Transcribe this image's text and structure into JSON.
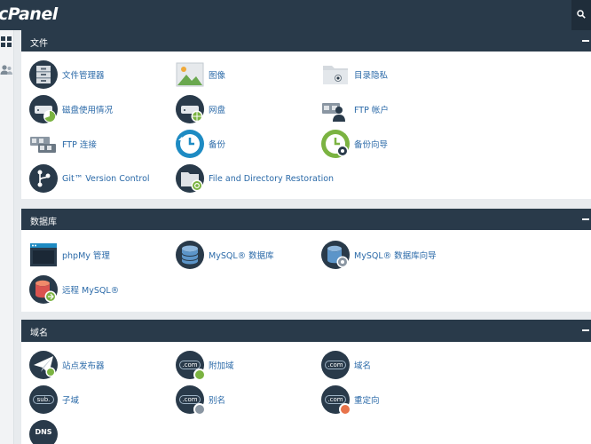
{
  "app": {
    "logo_text": "cPanel"
  },
  "colors": {
    "header": "#293a4a",
    "link": "#2b6aa8",
    "green": "#7bb341",
    "blue": "#1e8bc3"
  },
  "sections": [
    {
      "title": "文件",
      "items": [
        {
          "label": "文件管理器",
          "icon": "file-manager-icon"
        },
        {
          "label": "图像",
          "icon": "images-icon"
        },
        {
          "label": "目录隐私",
          "icon": "directory-privacy-icon"
        },
        {
          "label": "磁盘使用情况",
          "icon": "disk-usage-icon"
        },
        {
          "label": "网盘",
          "icon": "web-disk-icon"
        },
        {
          "label": "FTP 帐户",
          "icon": "ftp-accounts-icon"
        },
        {
          "label": "FTP 连接",
          "icon": "ftp-connections-icon"
        },
        {
          "label": "备份",
          "icon": "backup-icon"
        },
        {
          "label": "备份向导",
          "icon": "backup-wizard-icon"
        },
        {
          "label": "Git™ Version Control",
          "icon": "git-icon"
        },
        {
          "label": "File and Directory Restoration",
          "icon": "restore-icon"
        }
      ]
    },
    {
      "title": "数据库",
      "items": [
        {
          "label": "phpMy 管理",
          "icon": "phpmyadmin-icon"
        },
        {
          "label": "MySQL® 数据库",
          "icon": "mysql-icon"
        },
        {
          "label": "MySQL® 数据库向导",
          "icon": "mysql-wizard-icon"
        },
        {
          "label": "远程 MySQL®",
          "icon": "remote-mysql-icon"
        }
      ]
    },
    {
      "title": "域名",
      "items": [
        {
          "label": "站点发布器",
          "icon": "site-publisher-icon"
        },
        {
          "label": "附加域",
          "icon": "addon-domains-icon",
          "glyph": ".com"
        },
        {
          "label": "域名",
          "icon": "domains-icon",
          "glyph": ".com"
        },
        {
          "label": "子域",
          "icon": "subdomains-icon",
          "glyph": "sub."
        },
        {
          "label": "别名",
          "icon": "aliases-icon",
          "glyph": ".com"
        },
        {
          "label": "重定向",
          "icon": "redirects-icon",
          "glyph": ".com"
        },
        {
          "label": "",
          "icon": "dns-icon",
          "glyph": "DNS"
        }
      ]
    }
  ]
}
